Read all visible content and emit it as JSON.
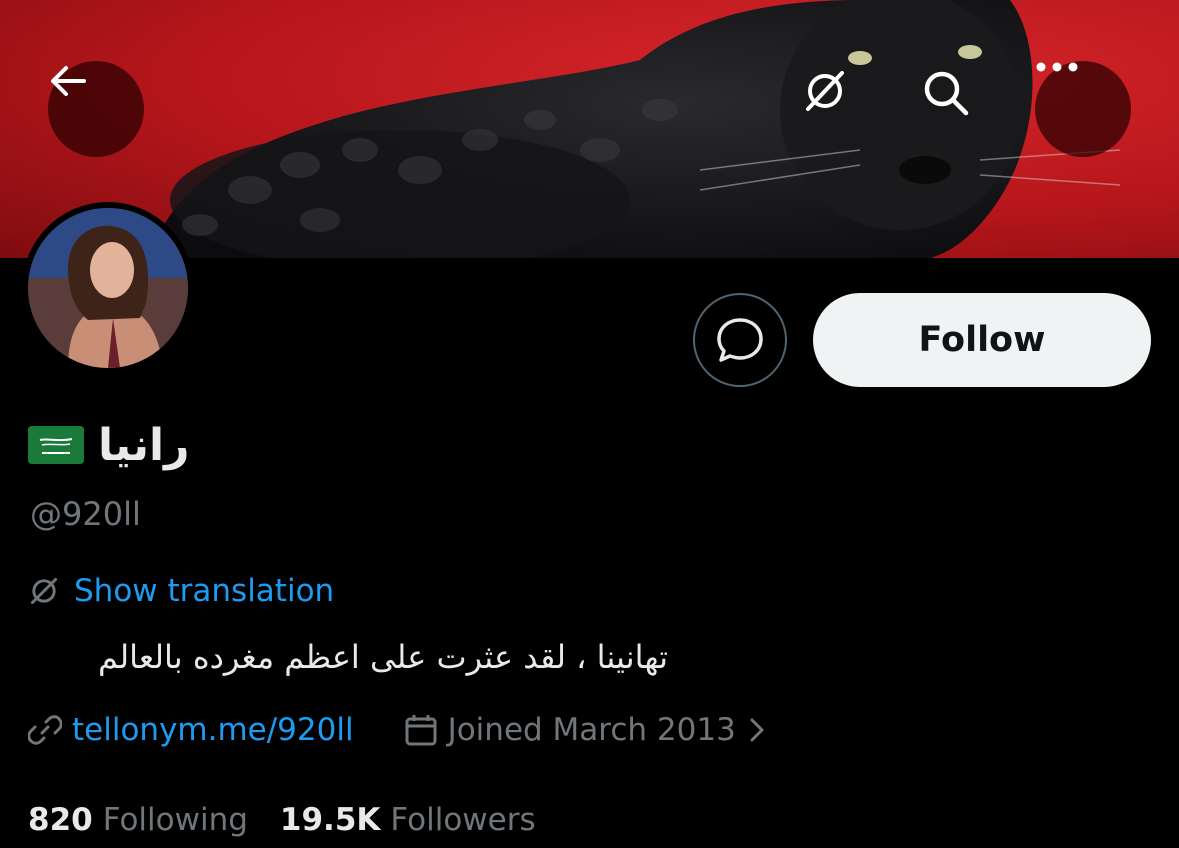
{
  "profile": {
    "display_name": "رانيا",
    "flag": "Saudi Arabia flag",
    "handle": "@920ll",
    "bio": "تهانينا ، لقد عثرت على اعظم مغرده بالعالم",
    "show_translation_label": "Show translation",
    "website": "tellonym.me/920ll",
    "joined": "Joined March 2013",
    "following_count": "820",
    "following_label": "Following",
    "followers_count": "19.5K",
    "followers_label": "Followers"
  },
  "actions": {
    "follow_label": "Follow"
  },
  "colors": {
    "background": "#000000",
    "link": "#1d9bf0",
    "secondary_text": "#71767b",
    "banner_red": "#c41e24"
  },
  "icons": [
    "back-arrow-icon",
    "translate-icon",
    "search-icon",
    "more-icon",
    "message-icon",
    "link-icon",
    "calendar-icon",
    "chevron-right-icon"
  ]
}
